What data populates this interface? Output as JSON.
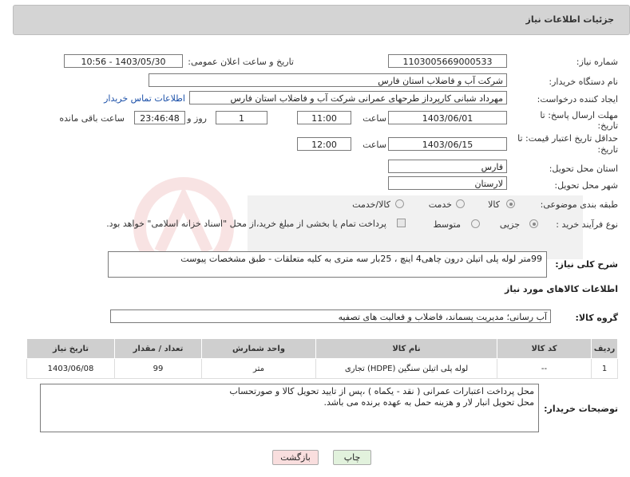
{
  "header": {
    "title": "جزئیات اطلاعات نیاز"
  },
  "fields": {
    "need_number": {
      "label": "شماره نیاز:",
      "value": "1103005669000533"
    },
    "announce_datetime": {
      "label": "تاریخ و ساعت اعلان عمومی:",
      "value": "1403/05/30 - 10:56"
    },
    "buyer_org": {
      "label": "نام دستگاه خریدار:",
      "value": "شرکت آب و فاضلاب استان فارس"
    },
    "requester": {
      "label": "ایجاد کننده درخواست:",
      "value": "مهرداد شبانی کارپرداز طرحهای عمرانی  شرکت آب و فاضلاب استان فارس",
      "contact_link": "اطلاعات تماس خریدار"
    },
    "deadline": {
      "label_line1": "مهلت ارسال پاسخ: تا",
      "label_line2": "تاریخ:",
      "date": "1403/06/01",
      "time_label": "ساعت",
      "time": "11:00",
      "days": "1",
      "days_label": "روز و",
      "remaining": "23:46:48",
      "remaining_label": "ساعت باقی مانده"
    },
    "price_validity": {
      "label_line1": "حداقل تاریخ اعتبار قیمت: تا",
      "label_line2": "تاریخ:",
      "date": "1403/06/15",
      "time_label": "ساعت",
      "time": "12:00"
    },
    "province": {
      "label": "استان محل تحویل:",
      "value": "فارس"
    },
    "city": {
      "label": "شهر محل تحویل:",
      "value": "لارستان"
    },
    "category": {
      "label": "طبقه بندی موضوعی:",
      "options": [
        "کالا",
        "خدمت",
        "کالا/خدمت"
      ]
    },
    "process": {
      "label": "نوع فرآیند خرید :",
      "options": [
        "جزیی",
        "متوسط"
      ],
      "treasury_note": "پرداخت تمام یا بخشی از مبلغ خرید،از محل \"اسناد خزانه اسلامی\" خواهد بود."
    }
  },
  "description": {
    "label": "شرح کلی نیاز:",
    "value": "99متر لوله پلی اتیلن درون چاهی4 اینچ ، 25بار سه متری به کلیه متعلقات - طبق مشخصات پیوست"
  },
  "goods_section": {
    "title": "اطلاعات کالاهای مورد نیاز",
    "group_label": "گروه کالا:",
    "group_value": "آب رسانی؛ مدیریت پسماند، فاضلاب و فعالیت های تصفیه"
  },
  "table": {
    "headers": [
      "ردیف",
      "کد کالا",
      "نام کالا",
      "واحد شمارش",
      "تعداد / مقدار",
      "تاریخ نیاز"
    ],
    "rows": [
      [
        "1",
        "--",
        "لوله پلی اتیلن سنگین (HDPE) تجاری",
        "متر",
        "99",
        "1403/06/08"
      ]
    ]
  },
  "buyer_notes": {
    "label": "توضیحات خریدار:",
    "line1": "محل پرداخت اعتبارات عمرانی ( نقد - یکماه )    ،پس از تایید تحویل کالا و صورتحساب",
    "line2": "محل تحویل  انبار لار و هزینه حمل به عهده برنده می باشد."
  },
  "buttons": {
    "print": "چاپ",
    "back": "بازگشت"
  },
  "colors": {
    "panel_bg": "#d4d4d4",
    "table_header_bg": "#cfcfcf",
    "link": "#1a4fa8",
    "back_btn_bg": "#f9dede",
    "print_btn_bg": "#e2f2dd"
  }
}
